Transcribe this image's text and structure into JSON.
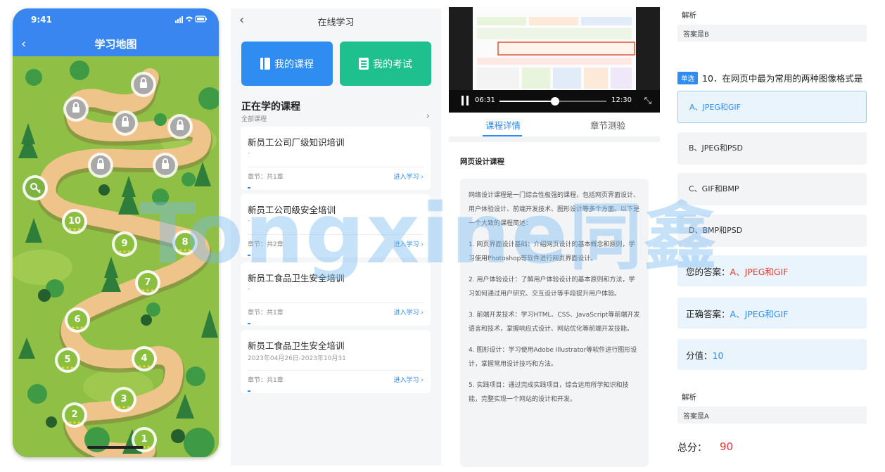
{
  "map_screen": {
    "time": "9:41",
    "status_icons": "signal-wifi-battery",
    "title": "学习地图",
    "levels": [
      "1",
      "2",
      "3",
      "4",
      "5",
      "6",
      "7",
      "8",
      "9",
      "10"
    ],
    "colors": {
      "header": "#3a86f0",
      "grass": "#8fbf45",
      "path": "#efc48a"
    }
  },
  "online_screen": {
    "title": "在线学习",
    "my_courses_label": "我的课程",
    "my_exams_label": "我的考试",
    "section_title": "正在学的课程",
    "all_courses_label": "全部课程",
    "courses": [
      {
        "title": "新员工公司厂级知识培训",
        "date": "-",
        "chapters": "章节：共1章",
        "link": "进入学习 ›"
      },
      {
        "title": "新员工公司级安全培训",
        "date": "-",
        "chapters": "章节：共2章",
        "link": "进入学习 ›"
      },
      {
        "title": "新员工食品卫生安全培训",
        "date": "-",
        "chapters": "章节：共1章",
        "link": "进入学习 ›"
      },
      {
        "title": "新员工食品卫生安全培训",
        "date": "2023年04月26日-2023年10月31",
        "chapters": "章节：共1章",
        "link": "进入学习 ›"
      }
    ]
  },
  "detail_screen": {
    "video": {
      "current": "06:31",
      "duration": "12:30",
      "progress": 0.52
    },
    "tabs": [
      "课程详情",
      "章节测验"
    ],
    "heading": "网页设计课程",
    "paragraphs": [
      "网络设计课程是一门综合性极强的课程，包括网页界面设计、用户体验设计、前端开发技术、图形设计等多个方面。以下是一个大致的课程简述：",
      "1. 网页界面设计基础：介绍网页设计的基本概念和原则，学习使用Photoshop等软件进行网页界面设计。",
      "2. 用户体验设计：了解用户体验设计的基本原则和方法，学习如何通过用户研究、交互设计等手段提升用户体验。",
      "3. 前端开发技术：学习HTML、CSS、JavaScript等前端开发语言和技术，掌握响应式设计、网站优化等前端开发技能。",
      "4. 图形设计：学习使用Adobe Illustrator等软件进行图形设计，掌握常用设计技巧和方法。",
      "5. 实践项目：通过完成实践项目，综合运用所学知识和技能，完整实现一个网站的设计和开发。"
    ]
  },
  "exam_screen": {
    "analysis_label": "解析",
    "prev_analysis": "答案是B",
    "question_tag": "单选",
    "question": "10．在网页中最为常用的两种图像格式是",
    "options": [
      "A、JPEG和GIF",
      "B、JPEG和PSD",
      "C、GIF和BMP",
      "D、BMP和PSD"
    ],
    "your_answer_label": "您的答案：",
    "your_answer": "A、JPEG和GIF",
    "correct_answer_label": "正确答案：",
    "correct_answer": "A、JPEG和GIF",
    "score_label": "分值：",
    "score": "10",
    "analysis": "答案是A",
    "total_label": "总分：",
    "total": "90"
  },
  "watermark": {
    "text": "Tongxine",
    "text_zh": "同鑫"
  }
}
